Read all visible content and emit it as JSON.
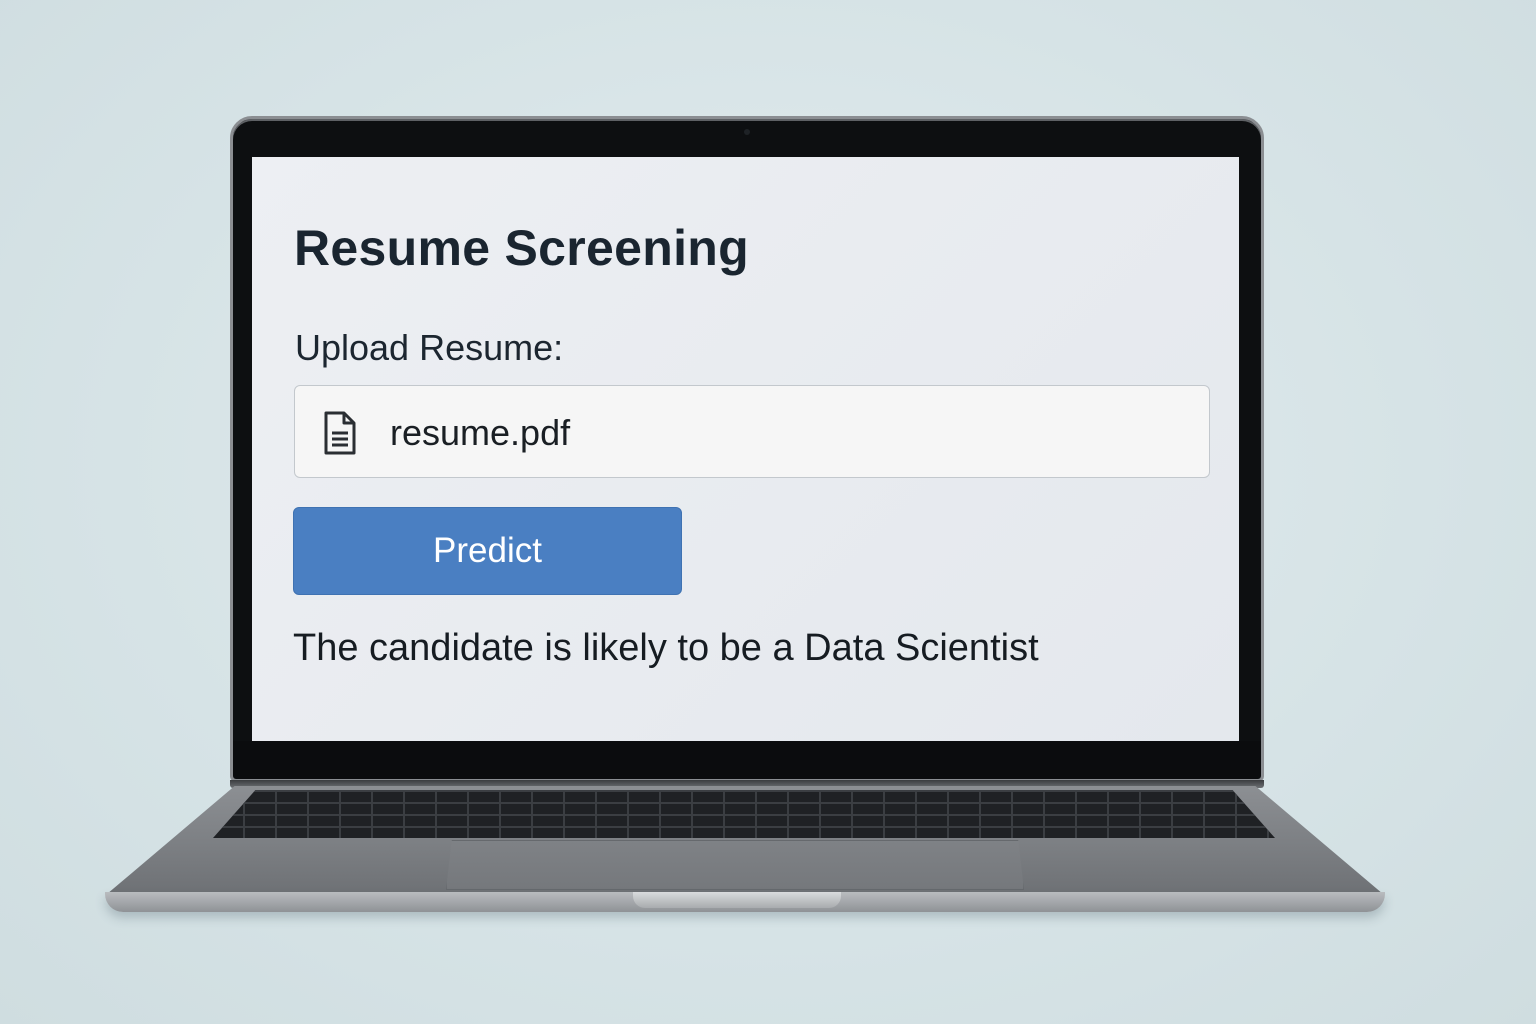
{
  "app": {
    "title": "Resume Screening",
    "upload_label": "Upload Resume:",
    "file_name": "resume.pdf",
    "file_icon": "document-icon",
    "predict_label": "Predict",
    "result": "The candidate is likely to be a Data Scientist"
  },
  "colors": {
    "accent": "#4a7fc2",
    "screen_background": "#e8ebef",
    "text": "#1a2530"
  }
}
